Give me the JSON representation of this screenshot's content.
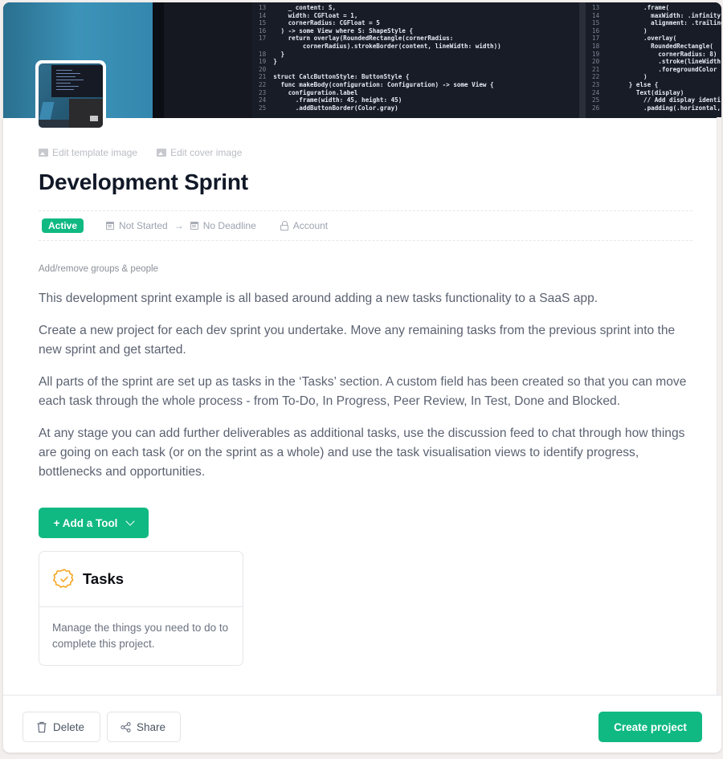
{
  "cover": {
    "code_left": [
      [
        "13",
        "    _ content: S,"
      ],
      [
        "14",
        "    width: CGFloat = 1,"
      ],
      [
        "15",
        "    cornerRadius: CGFloat = 5"
      ],
      [
        "16",
        "  ) -> some View where S: ShapeStyle {"
      ],
      [
        "17",
        "    return overlay(RoundedRectangle(cornerRadius:"
      ],
      [
        "",
        "        cornerRadius).strokeBorder(content, lineWidth: width))"
      ],
      [
        "18",
        "  }"
      ],
      [
        "19",
        "}"
      ],
      [
        "20",
        ""
      ],
      [
        "21",
        "struct CalcButtonStyle: ButtonStyle {"
      ],
      [
        "22",
        "  func makeBody(configuration: Configuration) -> some View {"
      ],
      [
        "23",
        "    configuration.label"
      ],
      [
        "24",
        "      .frame(width: 45, height: 45)"
      ],
      [
        "25",
        "      .addButtonBorder(Color.gray)"
      ]
    ],
    "code_right": [
      [
        "13",
        "          .frame("
      ],
      [
        "14",
        "            maxWidth: .infinity,"
      ],
      [
        "15",
        "            alignment: .trailing"
      ],
      [
        "16",
        "          )"
      ],
      [
        "17",
        "          .overlay("
      ],
      [
        "18",
        "            RoundedRectangle("
      ],
      [
        "19",
        "              cornerRadius: 8)"
      ],
      [
        "20",
        "              .stroke(lineWidth"
      ],
      [
        "21",
        "              .foregroundColor"
      ],
      [
        "22",
        "          )"
      ],
      [
        "23",
        "      } else {"
      ],
      [
        "24",
        "        Text(display)"
      ],
      [
        "25",
        "          // Add display identi"
      ],
      [
        "26",
        "          .padding(.horizontal,"
      ]
    ]
  },
  "edit_links": {
    "template_image": "Edit template image",
    "cover_image": "Edit cover image"
  },
  "title": "Development Sprint",
  "meta": {
    "status": "Active",
    "start": "Not Started",
    "arrow": "→",
    "deadline": "No Deadline",
    "access": "Account"
  },
  "groups_link": "Add/remove groups & people",
  "description": [
    "This development sprint example is all based around adding a new tasks functionality to a SaaS app.",
    "Create a new project for each dev sprint you undertake. Move any remaining tasks from the previous sprint into the new sprint and get started.",
    "All parts of the sprint are set up as tasks in the ‘Tasks’ section. A custom field has been created so that you can move each task through the whole process - from To-Do, In Progress, Peer Review, In Test, Done and Blocked.",
    "At any stage you can add further deliverables as additional tasks, use the discussion feed to chat through how things are going on each task (or on the sprint as a whole) and use the task visualisation views to identify progress, bottlenecks and opportunities."
  ],
  "add_tool_label": "+ Add a Tool",
  "tools": [
    {
      "title": "Tasks",
      "icon": "badge-check-icon",
      "description": "Manage the things you need to do to complete this project."
    }
  ],
  "footer": {
    "delete_label": "Delete",
    "share_label": "Share",
    "create_label": "Create project"
  },
  "colors": {
    "accent": "#10b981",
    "task_icon": "#f5a623",
    "title": "#111827",
    "body_text": "#5b6271"
  }
}
